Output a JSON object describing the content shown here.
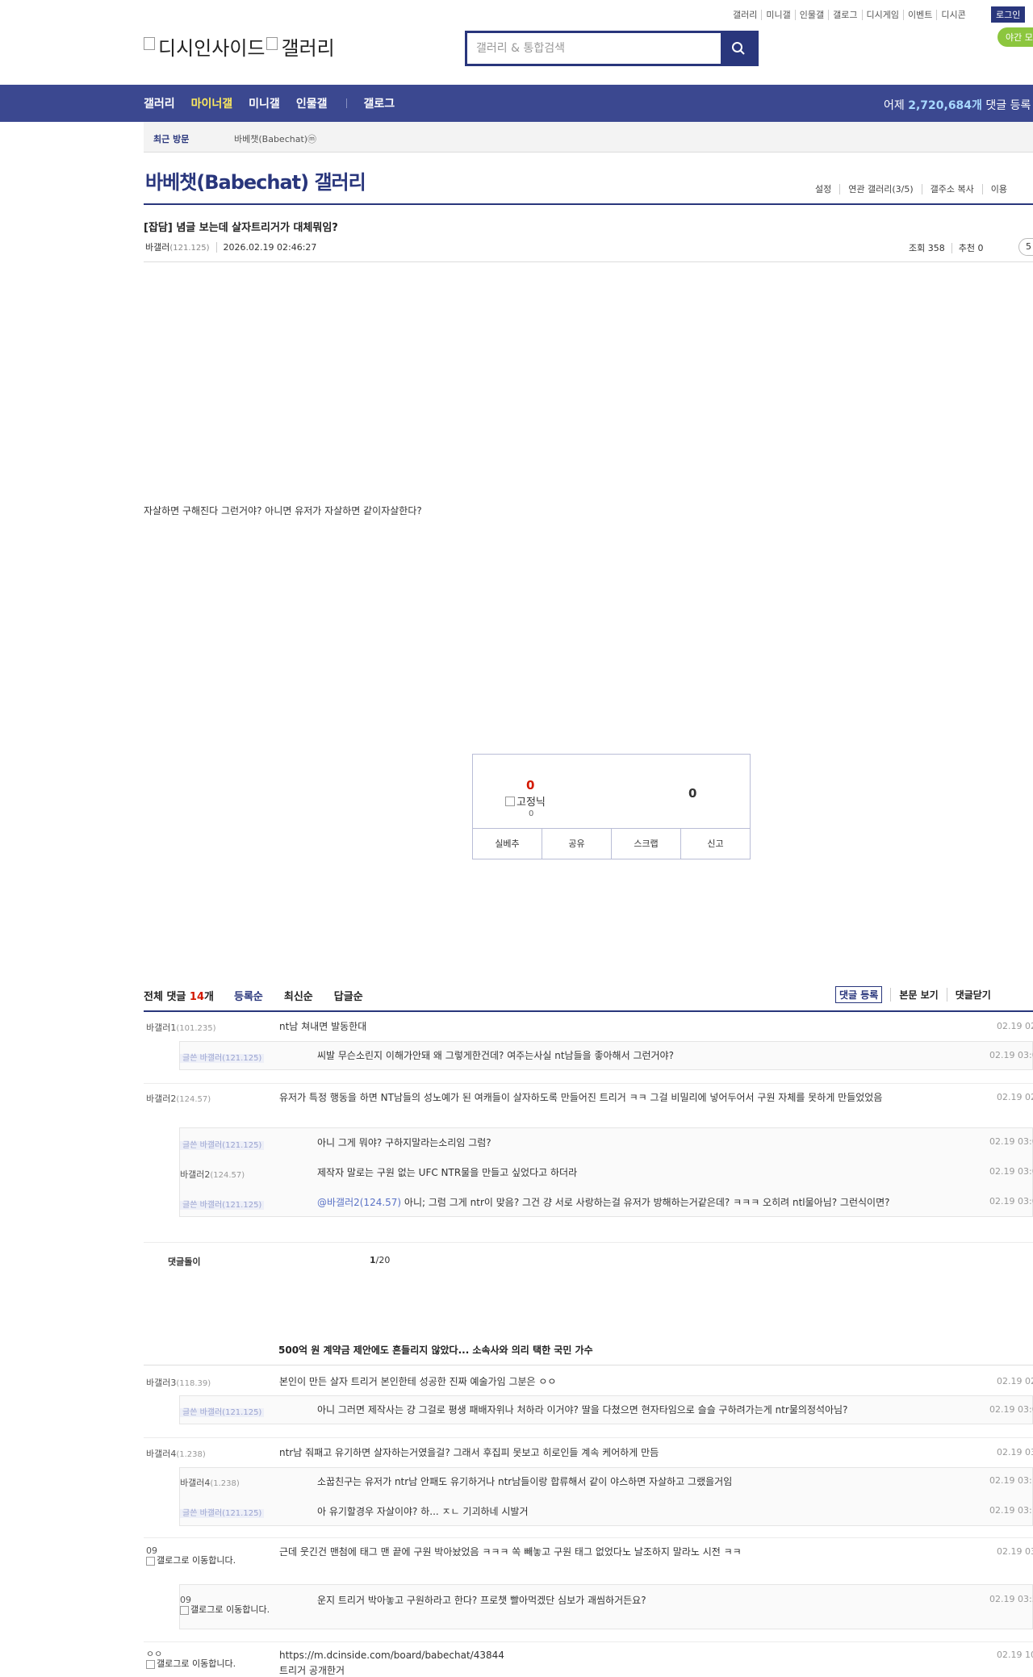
{
  "util": {
    "items": [
      "갤러리",
      "미니갤",
      "인물갤",
      "갤로그",
      "디시게임",
      "이벤트",
      "디시콘"
    ],
    "login": "로그인",
    "night_mode": "야간 모"
  },
  "logo": {
    "alt1": "디시인사이드",
    "alt2": "갤러리"
  },
  "search": {
    "placeholder": "갤러리 & 통합검색"
  },
  "nav": {
    "items": [
      "갤러리",
      "마이너갤",
      "미니갤",
      "인물갤",
      "갤로그"
    ],
    "stat_prefix": "어제 ",
    "stat_value": "2,720,684개",
    "stat_suffix": " 댓글 등록"
  },
  "recent": {
    "label": "최근 방문",
    "item": "바베챗(Babechat)ⓜ"
  },
  "gallery": {
    "title": "바베챗(Babechat) 갤러리",
    "menu": [
      "설정",
      "연관 갤러리(3/5)",
      "갤주소 복사",
      "이용"
    ]
  },
  "post": {
    "title": "[잡담] 념글 보는데 살자트리거가 대체뭐임?",
    "writer": "바갤러",
    "writer_ip": "(121.125)",
    "date": "2026.02.19 02:46:27",
    "views": "조회 358",
    "recommend": "추천 0",
    "comment_badge": "5",
    "body": "자살하면 구해진다 그런거야? 아니면 유저가 자살하면 같이자살한다?"
  },
  "recommend": {
    "up_count": "0",
    "fixed_label": "고정닉",
    "fixed_count": "0",
    "down_count": "0",
    "buttons": [
      "실베추",
      "공유",
      "스크랩",
      "신고"
    ]
  },
  "comments_header": {
    "total_label": "전체 댓글 ",
    "total_count": "14",
    "total_suffix": "개",
    "sorts": [
      "등록순",
      "최신순",
      "답글순"
    ],
    "register": "댓글 등록",
    "view_body": "본문 보기",
    "close": "댓글닫기"
  },
  "comments": [
    {
      "nick": "바갤러1",
      "ip": "(101.235)",
      "text": "nt남 쳐내면 발동한대",
      "time": "02.19 02"
    },
    {
      "writer_tag": "글쓴 바갤러(121.125)",
      "text": "씨발 무슨소린지 이해가안돼 왜 그렇게한건데? 여주는사실 nt남들을 좋아해서 그런거야?",
      "time": "02.19 03:0"
    },
    {
      "nick": "바갤러2",
      "ip": "(124.57)",
      "text": "유저가 특정 행동을 하면 NT남들의 성노예가 된 여캐들이 살자하도록 만들어진 트리거 ㅋㅋ 그걸 비밀리에 넣어두어서 구원 자체를 못하게 만들었었음",
      "time": "02.19 02"
    },
    {
      "writer_tag": "글쓴 바갤러(121.125)",
      "text": "아니 그게 뭐야? 구하지말라는소리임 그럼?",
      "time": "02.19 03:0"
    },
    {
      "nick": "바갤러2",
      "ip": "(124.57)",
      "text": "제작자 말로는 구원 없는 UFC NTR물을 만들고 싶었다고 하더라",
      "time": "02.19 03:0"
    },
    {
      "writer_tag": "글쓴 바갤러(121.125)",
      "mention": "@바갤러2(124.57)",
      "text": " 아니; 그럼 그게 ntr이 맞음? 그건 걍 서로 사랑하는걸 유저가 방해하는거같은데? ㅋㅋㅋ 오히려 ntl물아님? 그런식이면?",
      "time": "02.19 03:0"
    },
    {
      "nick": "바갤러3",
      "ip": "(118.39)",
      "text": "본인이 만든 살자 트리거 본인한테 성공한 진짜 예술가임 그분은 ㅇㅇ",
      "time": "02.19 02"
    },
    {
      "writer_tag": "글쓴 바갤러(121.125)",
      "text": "아니 그러면 제작사는 걍 그걸로 평생 패배자위나 처하라 이거야? 딸을 다쳤으면 현자타임으로 슬슬 구하려가는게 ntr물의정석아님?",
      "time": "02.19 03:0"
    },
    {
      "nick": "바갤러4",
      "ip": "(1.238)",
      "text": "ntr남 줘패고 유기하면 살자하는거였을걸? 그래서 후집피 못보고 히로인들 계속 케어하게 만듬",
      "time": "02.19 03"
    },
    {
      "nick": "바갤러4",
      "ip": "(1.238)",
      "text": "소꿉친구는 유저가 ntr남 안패도 유기하거나 ntr남들이랑 합류해서 같이 야스하면 자살하고 그랬을거임",
      "time": "02.19 03:1"
    },
    {
      "writer_tag": "글쓴 바갤러(121.125)",
      "text": "아 유기할경우 자살이야? 하... ㅈㄴ 기괴하네 시발거",
      "time": "02.19 03:1"
    },
    {
      "nick_top": "09",
      "nick_img": "갤로그로 이동합니다.",
      "text": "근데 웃긴건 맨첨에 태그 맨 끝에 구원 박아놨었음 ㅋㅋㅋ 쏙 빼놓고 구원 태그 없었다노 날조하지 말라노 시전 ㅋㅋ",
      "time": "02.19 03"
    },
    {
      "nick_top": "09",
      "nick_img": "갤로그로 이동합니다.",
      "text": "운지 트리거 박아놓고 구원하라고 한다? 프로챗 빨아먹겠단 심보가 괘씸하거든요?",
      "time": "02.19 03:5"
    },
    {
      "nick_top": "ㅇㅇ",
      "nick_img": "갤로그로 이동합니다.",
      "text": "https://m.dcinside.com/board/babechat/43844",
      "text2": "트리거 공개한거",
      "time": "02.19 10"
    }
  ],
  "pager": {
    "label": "댓글돌이",
    "current": "1",
    "total": "/20"
  },
  "ad": {
    "title": "500억 원 계약금 제안에도 흔들리지 않았다... 소속사와 의리 택한 국민 가수"
  },
  "colors": {
    "primary": "#29367c",
    "nav_bg": "#3b4890",
    "active": "#fdea5e",
    "red": "#d31900"
  }
}
